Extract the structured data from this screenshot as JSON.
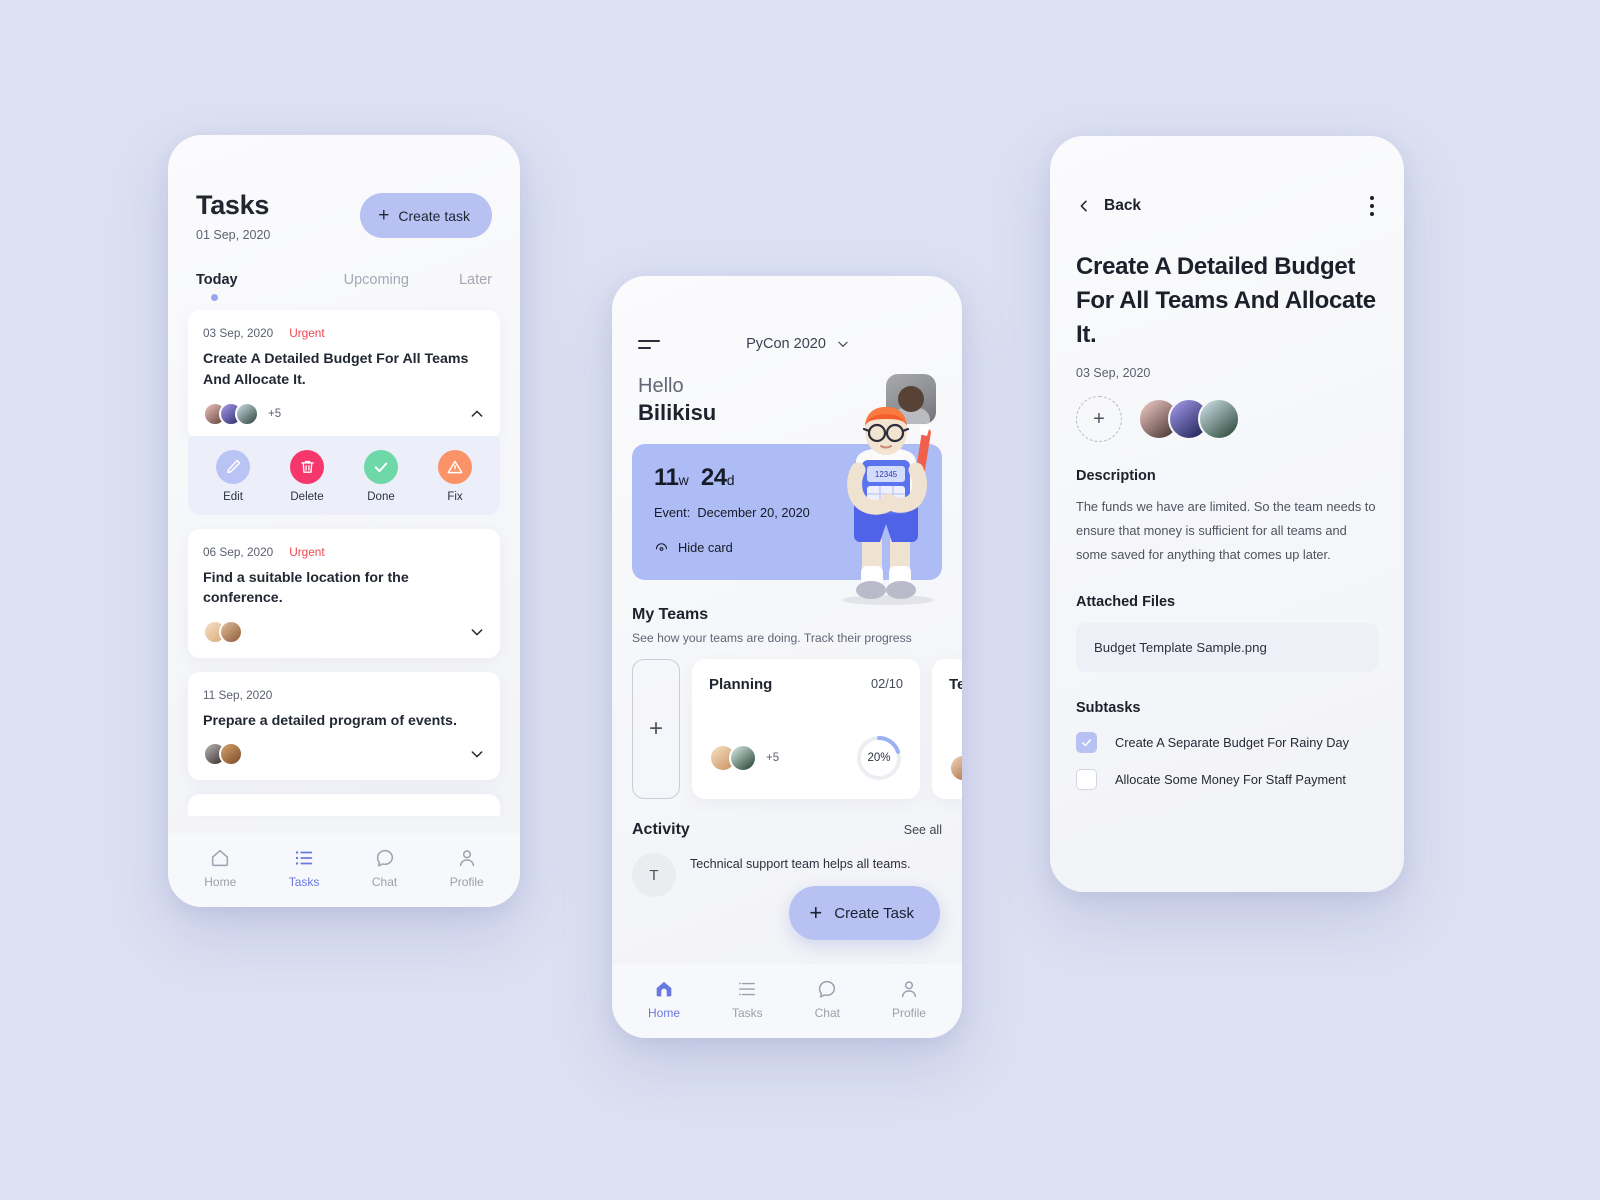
{
  "theme": {
    "background": "#dce0f2",
    "accent": "#b7c1f2",
    "accent_strong": "#aebcf5",
    "danger": "#f0454f",
    "delete": "#f5376c",
    "done": "#6ed8a8",
    "fix": "#fa9367",
    "nav_active": "#6a79e0"
  },
  "phone1": {
    "title": "Tasks",
    "date": "01 Sep, 2020",
    "create_button": "Create task",
    "tabs": [
      {
        "label": "Today",
        "active": true
      },
      {
        "label": "Upcoming",
        "active": false
      },
      {
        "label": "Later",
        "active": false
      }
    ],
    "cards": [
      {
        "date": "03 Sep, 2020",
        "flag": "Urgent",
        "title": "Create A Detailed Budget For All Teams And Allocate It.",
        "extra_members": "+5",
        "expanded": true
      },
      {
        "date": "06 Sep, 2020",
        "flag": "Urgent",
        "title": "Find a suitable location for the conference.",
        "extra_members": "",
        "expanded": false
      },
      {
        "date": "11 Sep, 2020",
        "flag": "",
        "title": "Prepare a detailed program of events.",
        "extra_members": "",
        "expanded": false
      }
    ],
    "actions": [
      {
        "label": "Edit",
        "icon": "pencil-icon"
      },
      {
        "label": "Delete",
        "icon": "trash-icon"
      },
      {
        "label": "Done",
        "icon": "check-icon"
      },
      {
        "label": "Fix",
        "icon": "warning-icon"
      }
    ],
    "nav": [
      {
        "label": "Home",
        "icon": "home-icon",
        "active": false
      },
      {
        "label": "Tasks",
        "icon": "list-icon",
        "active": true
      },
      {
        "label": "Chat",
        "icon": "chat-icon",
        "active": false
      },
      {
        "label": "Profile",
        "icon": "person-icon",
        "active": false
      }
    ]
  },
  "phone2": {
    "project": "PyCon 2020",
    "greeting_small": "Hello",
    "greeting_name": "Bilikisu",
    "countdown": {
      "weeks_value": "11",
      "weeks_unit": "w",
      "days_value": "24",
      "days_unit": "d",
      "event_label": "Event:",
      "event_date": "December 20, 2020",
      "hide_label": "Hide card"
    },
    "teams_title": "My Teams",
    "teams_subtitle": "See how your teams are doing. Track their progress",
    "teams": [
      {
        "name": "Planning",
        "count": "02/10",
        "extra_members": "+5",
        "progress": "20%",
        "progress_value": 20
      },
      {
        "name": "Testing Team",
        "count": "",
        "extra_members": "",
        "progress": "",
        "progress_value": 0
      }
    ],
    "activity_title": "Activity",
    "see_all": "See all",
    "activity": [
      {
        "avatar_initial": "T",
        "text": "Technical support team helps all teams."
      }
    ],
    "fab_label": "Create Task",
    "nav": [
      {
        "label": "Home",
        "icon": "home-icon",
        "active": true
      },
      {
        "label": "Tasks",
        "icon": "list-icon",
        "active": false
      },
      {
        "label": "Chat",
        "icon": "chat-icon",
        "active": false
      },
      {
        "label": "Profile",
        "icon": "person-icon",
        "active": false
      }
    ]
  },
  "phone3": {
    "back_label": "Back",
    "title": "Create A Detailed Budget For All Teams And Allocate It.",
    "date": "03 Sep, 2020",
    "description_heading": "Description",
    "description": "The funds we have are limited. So the team needs to ensure that money is sufficient for all teams and some saved for anything that comes up later.",
    "files_heading": "Attached Files",
    "files": [
      "Budget Template Sample.png"
    ],
    "subtasks_heading": "Subtasks",
    "subtasks": [
      {
        "label": "Create A Separate Budget For Rainy Day",
        "checked": true
      },
      {
        "label": "Allocate Some Money For Staff Payment",
        "checked": false
      }
    ]
  }
}
